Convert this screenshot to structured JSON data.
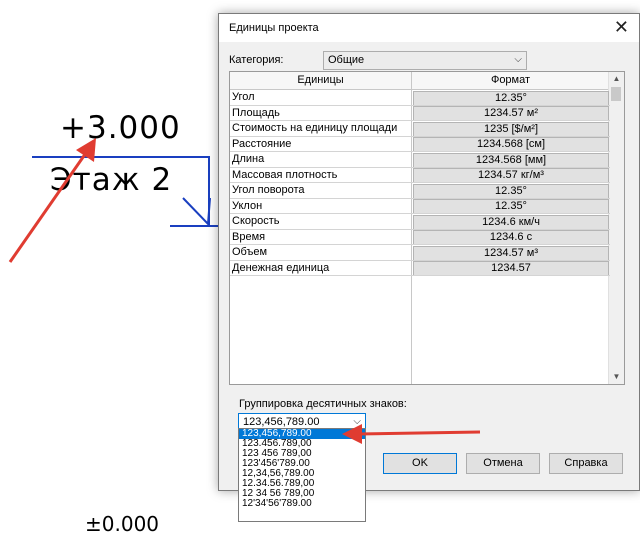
{
  "background": {
    "level_value": "+3.000",
    "level_name": "Этаж 2",
    "level_value_bottom": "±0.000"
  },
  "dialog": {
    "title": "Единицы проекта",
    "close_icon": "close-icon",
    "category": {
      "label": "Категория:",
      "value": "Общие"
    },
    "table": {
      "headers": [
        "Единицы",
        "Формат"
      ],
      "rows": [
        {
          "name": "Угол",
          "format": "12.35°"
        },
        {
          "name": "Площадь",
          "format": "1234.57 м²"
        },
        {
          "name": "Стоимость на единицу площади",
          "format": "1235 [$/м²]"
        },
        {
          "name": "Расстояние",
          "format": "1234.568 [см]"
        },
        {
          "name": "Длина",
          "format": "1234.568 [мм]"
        },
        {
          "name": "Массовая плотность",
          "format": "1234.57 кг/м³"
        },
        {
          "name": "Угол поворота",
          "format": "12.35°"
        },
        {
          "name": "Уклон",
          "format": "12.35°"
        },
        {
          "name": "Скорость",
          "format": "1234.6 км/ч"
        },
        {
          "name": "Время",
          "format": "1234.6 с"
        },
        {
          "name": "Объем",
          "format": "1234.57 м³"
        },
        {
          "name": "Денежная единица",
          "format": "1234.57"
        }
      ]
    },
    "grouping": {
      "label": "Группировка десятичных знаков:",
      "value": "123,456,789.00",
      "options": [
        "123,456,789.00",
        "123.456.789,00",
        "123 456 789,00",
        "123'456'789.00",
        "12,34,56,789.00",
        "12.34.56.789,00",
        "12 34 56 789,00",
        "12'34'56'789.00"
      ],
      "selected_index": 0
    },
    "buttons": {
      "ok": "OK",
      "cancel": "Отмена",
      "help": "Справка"
    }
  },
  "colors": {
    "annotation_arrow": "#e03c31",
    "selection": "#0078d7",
    "level_line": "#1a3fc0"
  }
}
